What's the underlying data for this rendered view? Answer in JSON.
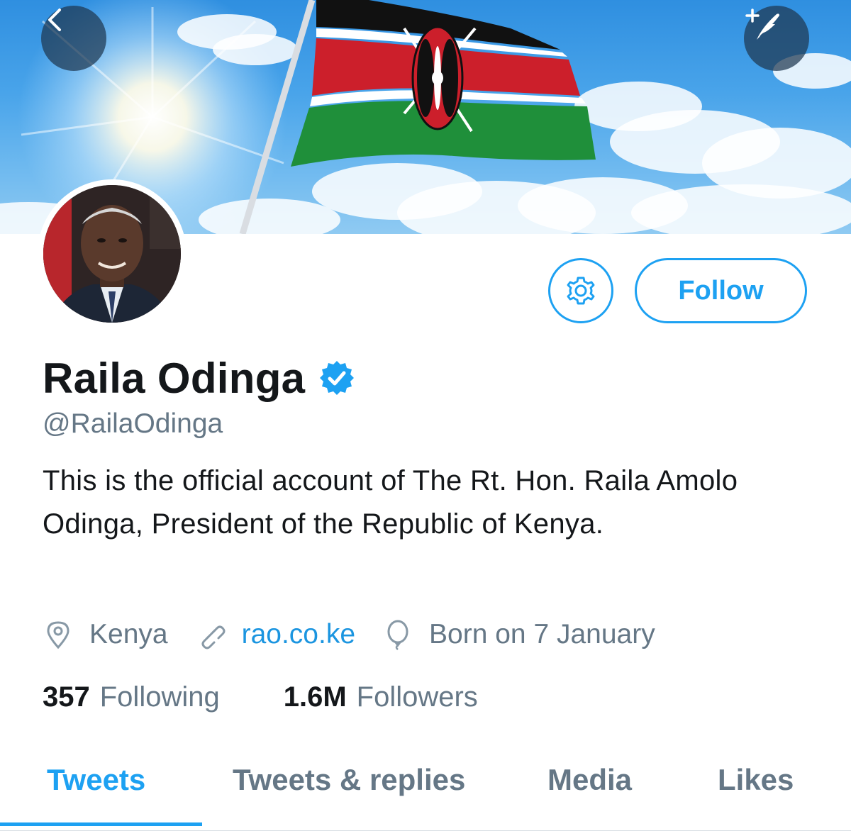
{
  "header": {
    "back_icon": "chevron-left-icon",
    "compose_icon": "compose-tweet-icon"
  },
  "profile": {
    "name": "Raila Odinga",
    "verified": true,
    "handle": "@RailaOdinga",
    "bio": "This is the official account of The Rt. Hon. Raila Amolo Odinga, President of the Republic of Kenya.",
    "location": "Kenya",
    "website": "rao.co.ke",
    "birthday": "Born on 7 January"
  },
  "actions": {
    "settings_icon": "gear-icon",
    "follow_label": "Follow"
  },
  "stats": {
    "following_count": "357",
    "following_label": "Following",
    "followers_count": "1.6M",
    "followers_label": "Followers"
  },
  "tabs": [
    {
      "label": "Tweets",
      "active": true
    },
    {
      "label": "Tweets & replies",
      "active": false
    },
    {
      "label": "Media",
      "active": false
    },
    {
      "label": "Likes",
      "active": false
    }
  ],
  "colors": {
    "accent": "#1da1f2",
    "text": "#14171a",
    "secondary": "#657786",
    "link": "#1b95e0"
  }
}
